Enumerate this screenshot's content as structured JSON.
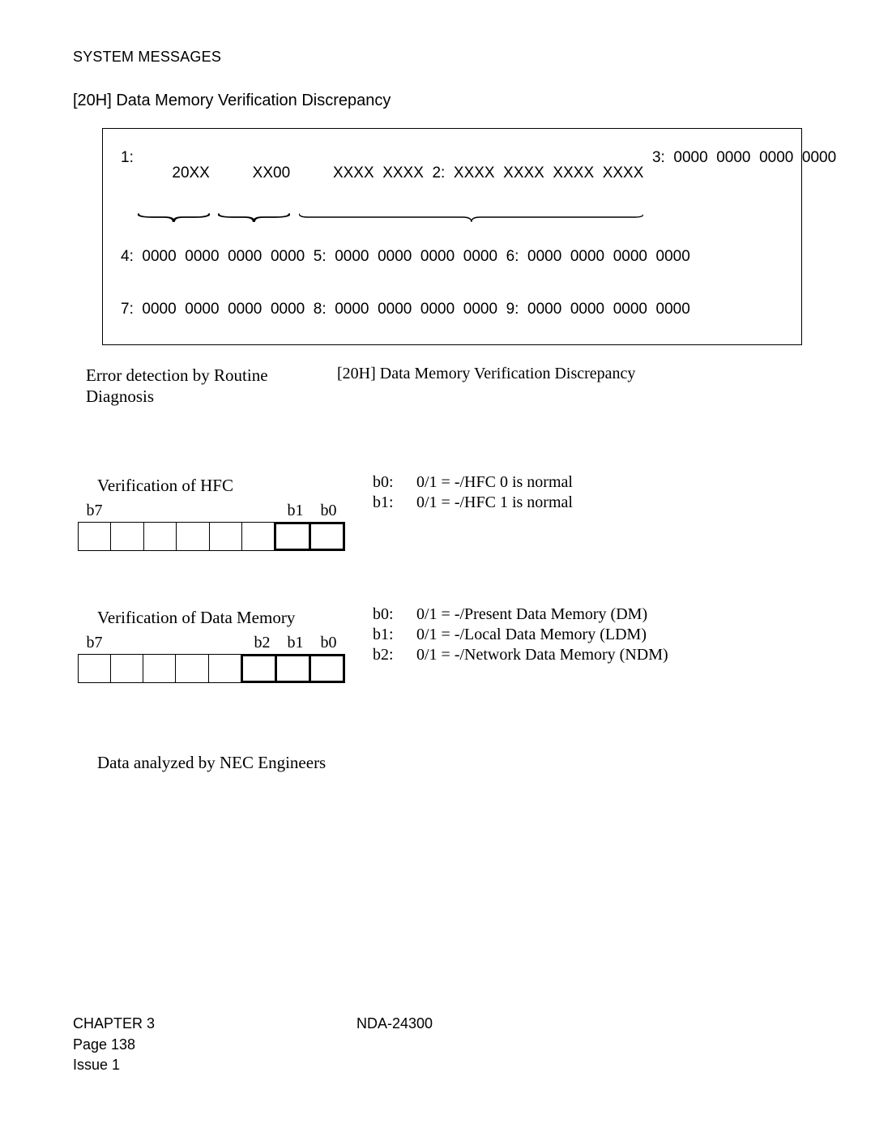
{
  "header": "SYSTEM MESSAGES",
  "title": "[20H] Data Memory Verification Discrepancy",
  "dump": {
    "r1": {
      "label": "1:",
      "a": "20XX",
      "b": "XX00",
      "c": "XXXX",
      "d": "XXXX"
    },
    "r2": {
      "label": "2:",
      "a": "XXXX",
      "b": "XXXX",
      "c": "XXXX",
      "d": "XXXX"
    },
    "r3": {
      "label": "3:",
      "a": "0000",
      "b": "0000",
      "c": "0000",
      "d": "0000"
    },
    "r4": {
      "label": "4:",
      "a": "0000",
      "b": "0000",
      "c": "0000",
      "d": "0000"
    },
    "r5": {
      "label": "5:",
      "a": "0000",
      "b": "0000",
      "c": "0000",
      "d": "0000"
    },
    "r6": {
      "label": "6:",
      "a": "0000",
      "b": "0000",
      "c": "0000",
      "d": "0000"
    },
    "r7": {
      "label": "7:",
      "a": "0000",
      "b": "0000",
      "c": "0000",
      "d": "0000"
    },
    "r8": {
      "label": "8:",
      "a": "0000",
      "b": "0000",
      "c": "0000",
      "d": "0000"
    },
    "r9": {
      "label": "9:",
      "a": "0000",
      "b": "0000",
      "c": "0000",
      "d": "0000"
    }
  },
  "caption": {
    "left": "Error detection by Routine Diagnosis",
    "right": "[20H] Data Memory Verification Discrepancy"
  },
  "sec1": {
    "title": "Verification of HFC",
    "b7": "b7",
    "b1": "b1",
    "b0": "b0",
    "d0k": "b0:",
    "d0v": "0/1 = -/HFC 0 is normal",
    "d1k": "b1:",
    "d1v": "0/1 = -/HFC 1 is normal"
  },
  "sec2": {
    "title": "Verification of Data Memory",
    "b7": "b7",
    "b2": "b2",
    "b1": "b1",
    "b0": "b0",
    "d0k": "b0:",
    "d0v": "0/1 = -/Present Data Memory (DM)",
    "d1k": "b1:",
    "d1v": "0/1 = -/Local Data Memory (LDM)",
    "d2k": "b2:",
    "d2v": "0/1 = -/Network Data Memory (NDM)"
  },
  "note": "Data analyzed by NEC Engineers",
  "footer": {
    "chapter": "CHAPTER 3",
    "page": "Page 138",
    "issue": "Issue 1",
    "doc": "NDA-24300"
  }
}
